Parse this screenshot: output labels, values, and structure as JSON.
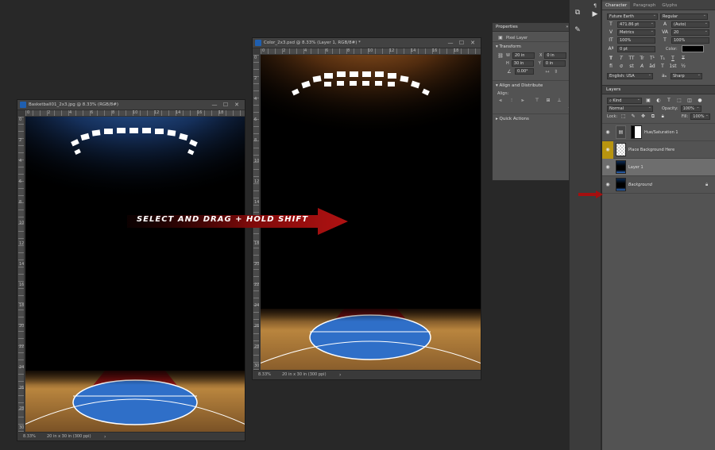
{
  "doc_left": {
    "title": "Basketball01_2x3.jpg @ 8.33% (RGB/8#)",
    "zoom": "8.33%",
    "size": "20 in x 30 in (300 ppi)",
    "ruler_h": [
      "0",
      "2",
      "4",
      "6",
      "8",
      "10",
      "12",
      "14",
      "16",
      "18"
    ],
    "ruler_v": [
      "0",
      "2",
      "4",
      "6",
      "8",
      "10",
      "12",
      "14",
      "16",
      "18",
      "20",
      "22",
      "24",
      "26",
      "28",
      "30"
    ]
  },
  "doc_right": {
    "title": "Color_2x3.psd @ 8.33% (Layer 1, RGB/8#) *",
    "zoom": "8.33%",
    "size": "20 in x 30 in (300 ppi)",
    "ruler_h": [
      "0",
      "2",
      "4",
      "6",
      "8",
      "10",
      "12",
      "14",
      "16",
      "18"
    ],
    "ruler_v": [
      "0",
      "2",
      "4",
      "6",
      "8",
      "10",
      "12",
      "14",
      "16",
      "18",
      "20",
      "22",
      "24",
      "26",
      "28",
      "30"
    ]
  },
  "annotation": {
    "label": "SELECT AND DRAG + HOLD SHIFT"
  },
  "properties": {
    "tab": "Properties",
    "layer_type": "Pixel Layer",
    "transform_head": "Transform",
    "w_label": "W",
    "w": "20 in",
    "h_label": "H",
    "h": "30 in",
    "x_label": "X",
    "x": "0 in",
    "y_label": "Y",
    "y": "0 in",
    "angle": "0.00°",
    "align_head": "Align and Distribute",
    "align_label": "Align:",
    "more": "...",
    "quick_head": "Quick Actions"
  },
  "character": {
    "tabs": [
      "Character",
      "Paragraph",
      "Glyphs"
    ],
    "font_family": "Future Earth",
    "font_style": "Regular",
    "font_size": "471.86 pt",
    "leading": "(Auto)",
    "kerning": "Metrics",
    "tracking": "20",
    "vscale": "100%",
    "hscale": "100%",
    "baseline": "0 pt",
    "color_label": "Color:",
    "language": "English: USA",
    "aa_symbol": "aₐ",
    "antialias": "Sharp",
    "style_buttons": [
      "T",
      "T",
      "TT",
      "Tr",
      "T¹",
      "T₁",
      "T",
      "T"
    ],
    "opentype_buttons": [
      "fi",
      "σ",
      "st",
      "A",
      "ād",
      "T",
      "1st",
      "½"
    ]
  },
  "layers": {
    "title": "Layers",
    "filter": "Kind",
    "blend": "Normal",
    "opacity_label": "Opacity:",
    "opacity": "100%",
    "lock_label": "Lock:",
    "fill_label": "Fill:",
    "fill": "100%",
    "items": [
      {
        "name": "Hue/Saturation 1",
        "selected": false,
        "italic": false
      },
      {
        "name": "Place Background Here",
        "selected": false,
        "italic": false
      },
      {
        "name": "Layer 1",
        "selected": true,
        "italic": false
      },
      {
        "name": "Background",
        "selected": false,
        "italic": true
      }
    ]
  },
  "colors": {
    "accent_red": "#a50f0f",
    "court_blue": "#2f6fc8",
    "wood": "#b9853e",
    "glow_blue": "#2a5ea8",
    "glow_orange": "#b8672a",
    "folder_gold": "#b8940f"
  }
}
